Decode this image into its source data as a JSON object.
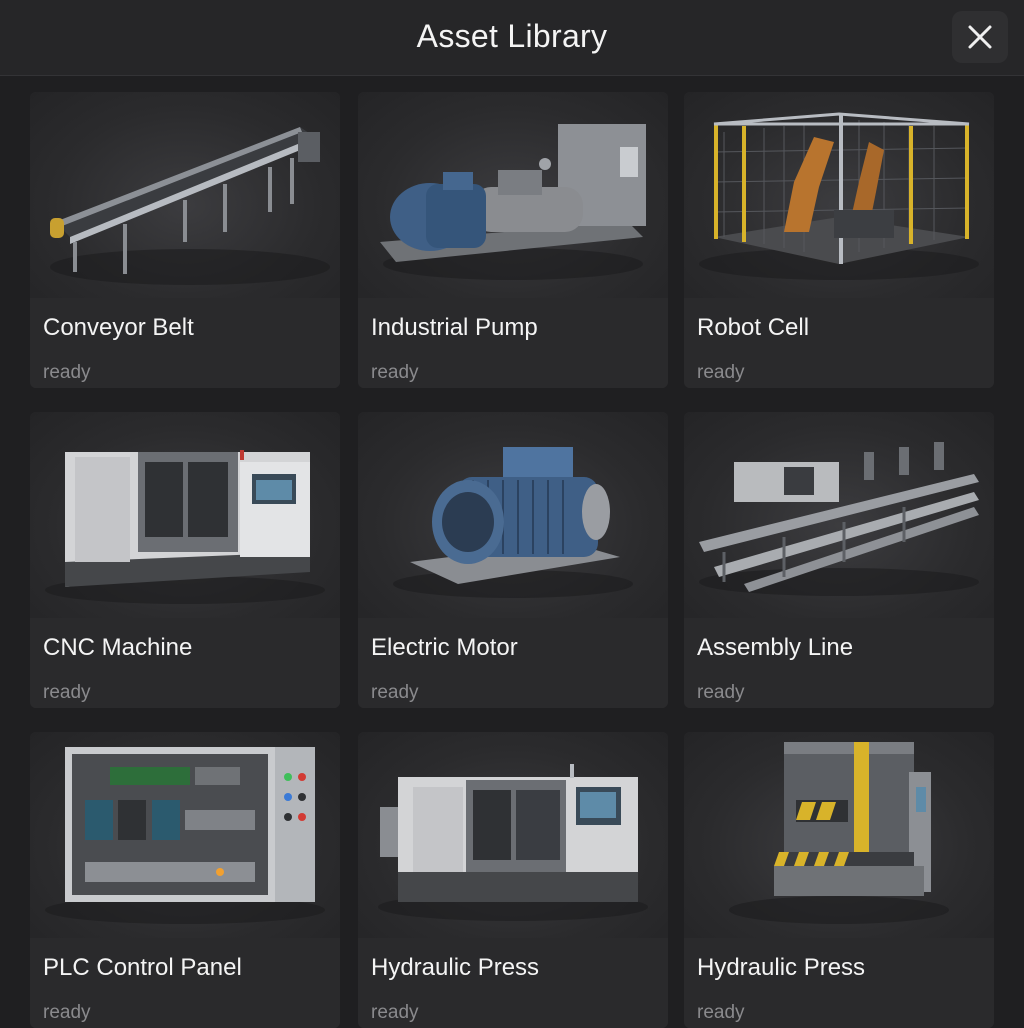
{
  "header": {
    "title": "Asset Library",
    "close_icon": "close-icon"
  },
  "assets": [
    {
      "name": "Conveyor Belt",
      "status": "ready",
      "icon": "conveyor-belt-image"
    },
    {
      "name": "Industrial Pump",
      "status": "ready",
      "icon": "industrial-pump-image"
    },
    {
      "name": "Robot Cell",
      "status": "ready",
      "icon": "robot-cell-image"
    },
    {
      "name": "CNC Machine",
      "status": "ready",
      "icon": "cnc-machine-image"
    },
    {
      "name": "Electric Motor",
      "status": "ready",
      "icon": "electric-motor-image"
    },
    {
      "name": "Assembly Line",
      "status": "ready",
      "icon": "assembly-line-image"
    },
    {
      "name": "PLC Control Panel",
      "status": "ready",
      "icon": "plc-control-panel-image"
    },
    {
      "name": "Hydraulic Press",
      "status": "ready",
      "icon": "cnc-machine-image"
    },
    {
      "name": "Hydraulic Press",
      "status": "ready",
      "icon": "hydraulic-press-image"
    }
  ],
  "colors": {
    "background": "#1f1f21",
    "card": "#2a2a2c",
    "status_text": "#8a8a8d",
    "accent_yellow": "#e5c028",
    "motor_blue": "#3f5f86"
  }
}
